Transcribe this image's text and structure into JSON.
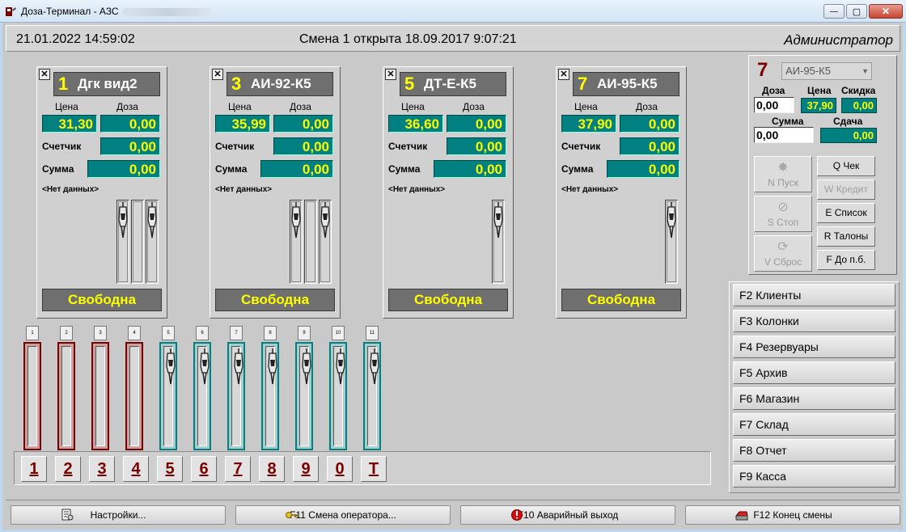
{
  "window": {
    "title": "Доза-Терминал - АЗС",
    "minimize_label": "—",
    "maximize_label": "▢",
    "close_label": "✕"
  },
  "header": {
    "datetime": "21.01.2022 14:59:02",
    "shift_status": "Смена 1 открыта 18.09.2017 9:07:21",
    "user_role": "Администратор"
  },
  "pump_cards": [
    {
      "number": "1",
      "fuel": "Дгк вид2",
      "price": "31,30",
      "dose": "0,00",
      "counter": "0,00",
      "sum": "0,00",
      "note": "<Нет данных>",
      "status": "Свободна",
      "nozzles": 3
    },
    {
      "number": "3",
      "fuel": "АИ-92-К5",
      "price": "35,99",
      "dose": "0,00",
      "counter": "0,00",
      "sum": "0,00",
      "note": "<Нет данных>",
      "status": "Свободна",
      "nozzles": 3
    },
    {
      "number": "5",
      "fuel": "ДТ-Е-К5",
      "price": "36,60",
      "dose": "0,00",
      "counter": "0,00",
      "sum": "0,00",
      "note": "<Нет данных>",
      "status": "Свободна",
      "nozzles": 1
    },
    {
      "number": "7",
      "fuel": "АИ-95-К5",
      "price": "37,90",
      "dose": "0,00",
      "counter": "0,00",
      "sum": "0,00",
      "note": "<Нет данных>",
      "status": "Свободна",
      "nozzles": 1
    }
  ],
  "card_labels": {
    "price": "Цена",
    "dose": "Доза",
    "counter": "Счетчик",
    "sum": "Сумма",
    "close": "✕"
  },
  "mini_pumps": [
    {
      "label": "1",
      "state": "red"
    },
    {
      "label": "2",
      "state": "red"
    },
    {
      "label": "3",
      "state": "red"
    },
    {
      "label": "4",
      "state": "red"
    },
    {
      "label": "5",
      "state": "teal"
    },
    {
      "label": "6",
      "state": "teal"
    },
    {
      "label": "7",
      "state": "teal"
    },
    {
      "label": "8",
      "state": "teal"
    },
    {
      "label": "9",
      "state": "teal"
    },
    {
      "label": "10",
      "state": "teal"
    },
    {
      "label": "11",
      "state": "teal"
    }
  ],
  "keypad": [
    "1",
    "2",
    "3",
    "4",
    "5",
    "6",
    "7",
    "8",
    "9",
    "0",
    "T"
  ],
  "control": {
    "pump_number": "7",
    "fuel_select": "АИ-95-К5",
    "labels": {
      "dose": "Доза",
      "price": "Цена",
      "discount": "Скидка",
      "sum": "Сумма",
      "change": "Сдача"
    },
    "dose_value": "0,00",
    "price_value": "37,90",
    "discount_value": "0,00",
    "sum_value": "0,00",
    "change_value": "0,00",
    "start_button": "N Пуск",
    "stop_button": "S Стоп",
    "reset_button": "V Сброс",
    "check_button": "Q Чек",
    "credit_button": "W Кредит",
    "list_button": "E Список",
    "coupons_button": "R Талоны",
    "upto_button": "F До п.б."
  },
  "function_menu": [
    "F2 Клиенты",
    "F3 Колонки",
    "F4 Резервуары",
    "F5 Архив",
    "F6 Магазин",
    "F7 Склад",
    "F8 Отчет",
    "F9 Касса"
  ],
  "bottom_buttons": [
    {
      "label": "Настройки...",
      "icon": "settings-doc-icon"
    },
    {
      "label": "F11 Смена оператора...",
      "icon": "key-icon"
    },
    {
      "label": "F10 Аварийный выход",
      "icon": "emergency-icon"
    },
    {
      "label": "F12 Конец смены",
      "icon": "cash-register-icon"
    }
  ],
  "colors": {
    "lcd_bg": "#008080",
    "lcd_text": "#ffff00",
    "status_bg": "#6f6f6f",
    "accent_red": "#7a0000"
  }
}
